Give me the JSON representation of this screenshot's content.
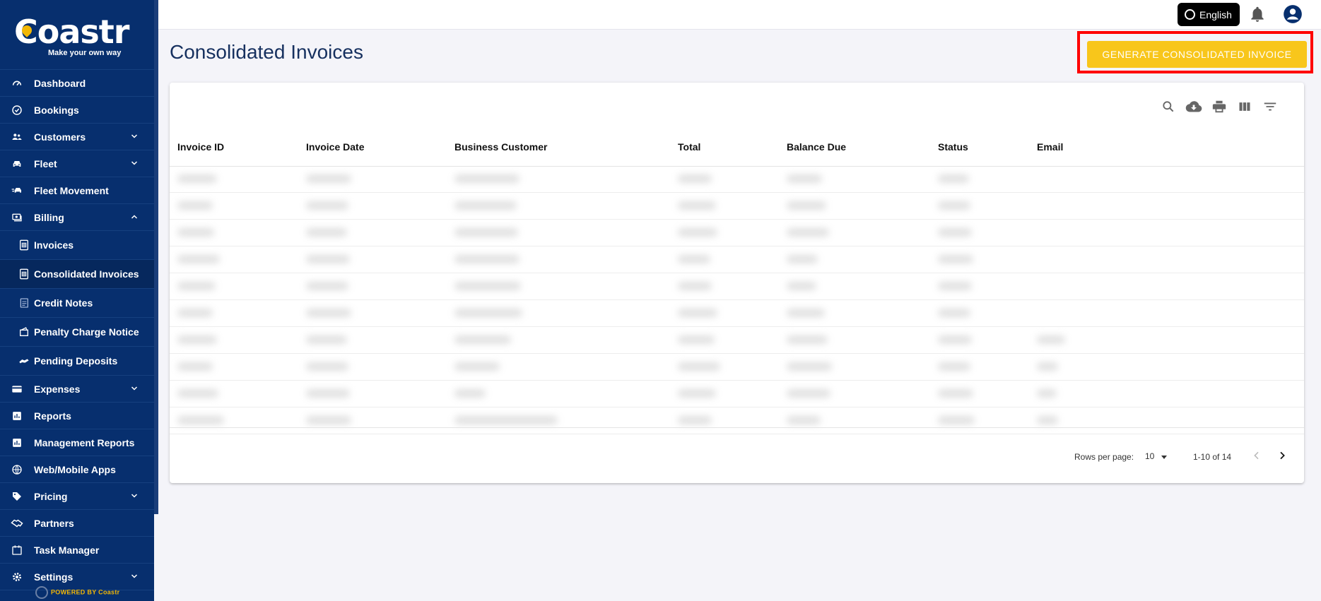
{
  "brand": {
    "name": "Coastr",
    "tagline": "Make your own way",
    "powered_by": "POWERED BY Coastr"
  },
  "sidebar": {
    "items": [
      {
        "label": "Dashboard",
        "icon": "speedometer-icon",
        "expandable": false
      },
      {
        "label": "Bookings",
        "icon": "check-circle-icon",
        "expandable": false
      },
      {
        "label": "Customers",
        "icon": "people-icon",
        "expandable": true
      },
      {
        "label": "Fleet",
        "icon": "car-icon",
        "expandable": true
      },
      {
        "label": "Fleet Movement",
        "icon": "car-move-icon",
        "expandable": false
      },
      {
        "label": "Billing",
        "icon": "billing-icon",
        "expandable": true,
        "expanded": true
      }
    ],
    "billing_sub": [
      {
        "label": "Invoices",
        "icon": "invoice-icon"
      },
      {
        "label": "Consolidated Invoices",
        "icon": "invoice-icon",
        "active": true
      },
      {
        "label": "Credit Notes",
        "icon": "credit-note-icon"
      },
      {
        "label": "Penalty Charge Notice",
        "icon": "wallet-icon"
      },
      {
        "label": "Pending Deposits",
        "icon": "deposit-icon"
      }
    ],
    "items_after": [
      {
        "label": "Expenses",
        "icon": "card-icon",
        "expandable": true
      },
      {
        "label": "Reports",
        "icon": "bar-chart-icon",
        "expandable": false
      },
      {
        "label": "Management Reports",
        "icon": "bar-chart-icon",
        "expandable": false
      },
      {
        "label": "Web/Mobile Apps",
        "icon": "globe-icon",
        "expandable": false
      },
      {
        "label": "Pricing",
        "icon": "tag-icon",
        "expandable": true
      },
      {
        "label": "Partners",
        "icon": "handshake-icon",
        "expandable": false
      },
      {
        "label": "Task Manager",
        "icon": "calendar-icon",
        "expandable": false
      },
      {
        "label": "Settings",
        "icon": "gear-icon",
        "expandable": true
      }
    ]
  },
  "topbar": {
    "language": "English"
  },
  "page": {
    "title": "Consolidated Invoices",
    "generate_button": "GENERATE CONSOLIDATED INVOICE"
  },
  "table": {
    "columns": [
      "Invoice ID",
      "Invoice Date",
      "Business Customer",
      "Total",
      "Balance Due",
      "Status",
      "Email"
    ],
    "row_count": 10,
    "rows_per_page_label": "Rows per page:",
    "rows_per_page": "10",
    "range": "1-10 of 14"
  },
  "colors": {
    "sidebar": "#072f6e",
    "accent": "#f8c61b",
    "highlight": "#ff0000"
  }
}
